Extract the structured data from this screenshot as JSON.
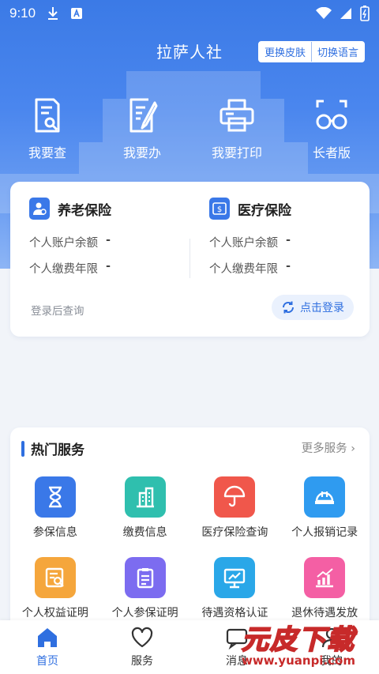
{
  "status_bar": {
    "time": "9:10"
  },
  "header": {
    "title": "拉萨人社",
    "change_skin": "更换皮肤",
    "change_language": "切换语言"
  },
  "quick_actions": [
    {
      "label": "我要查",
      "icon": "search-document-icon"
    },
    {
      "label": "我要办",
      "icon": "edit-document-icon"
    },
    {
      "label": "我要打印",
      "icon": "printer-icon"
    },
    {
      "label": "长者版",
      "icon": "glasses-icon"
    }
  ],
  "insurance": {
    "pension": {
      "title": "养老保险",
      "balance_label": "个人账户余额",
      "balance_value": "-",
      "years_label": "个人缴费年限",
      "years_value": "-"
    },
    "medical": {
      "title": "医疗保险",
      "balance_label": "个人账户余额",
      "balance_value": "-",
      "years_label": "个人缴费年限",
      "years_value": "-"
    },
    "login_hint": "登录后查询",
    "login_button": "点击登录"
  },
  "hot_services": {
    "title": "热门服务",
    "more": "更多服务",
    "items": [
      {
        "label": "参保信息",
        "icon": "hourglass-icon",
        "color": "#3a78e8"
      },
      {
        "label": "缴费信息",
        "icon": "building-icon",
        "color": "#2fbfae"
      },
      {
        "label": "医疗保险查询",
        "icon": "umbrella-icon",
        "color": "#f0574b"
      },
      {
        "label": "个人报销记录",
        "icon": "helmet-icon",
        "color": "#2f9bf0"
      },
      {
        "label": "个人权益证明",
        "icon": "doc-search-icon",
        "color": "#f5a63c"
      },
      {
        "label": "个人参保证明",
        "icon": "clipboard-icon",
        "color": "#7c6cf0"
      },
      {
        "label": "待遇资格认证",
        "icon": "monitor-chart-icon",
        "color": "#2aa7e8"
      },
      {
        "label": "退休待遇发放",
        "icon": "bar-chart-icon",
        "color": "#f45fa4"
      }
    ]
  },
  "tabbar": [
    {
      "label": "首页",
      "icon": "home-icon",
      "active": true
    },
    {
      "label": "服务",
      "icon": "heart-icon",
      "active": false
    },
    {
      "label": "消息",
      "icon": "message-icon",
      "active": false
    },
    {
      "label": "我的",
      "icon": "user-icon",
      "active": false
    }
  ],
  "watermark": {
    "brand": "元皮下载",
    "url": "www.yuanpi.com"
  }
}
